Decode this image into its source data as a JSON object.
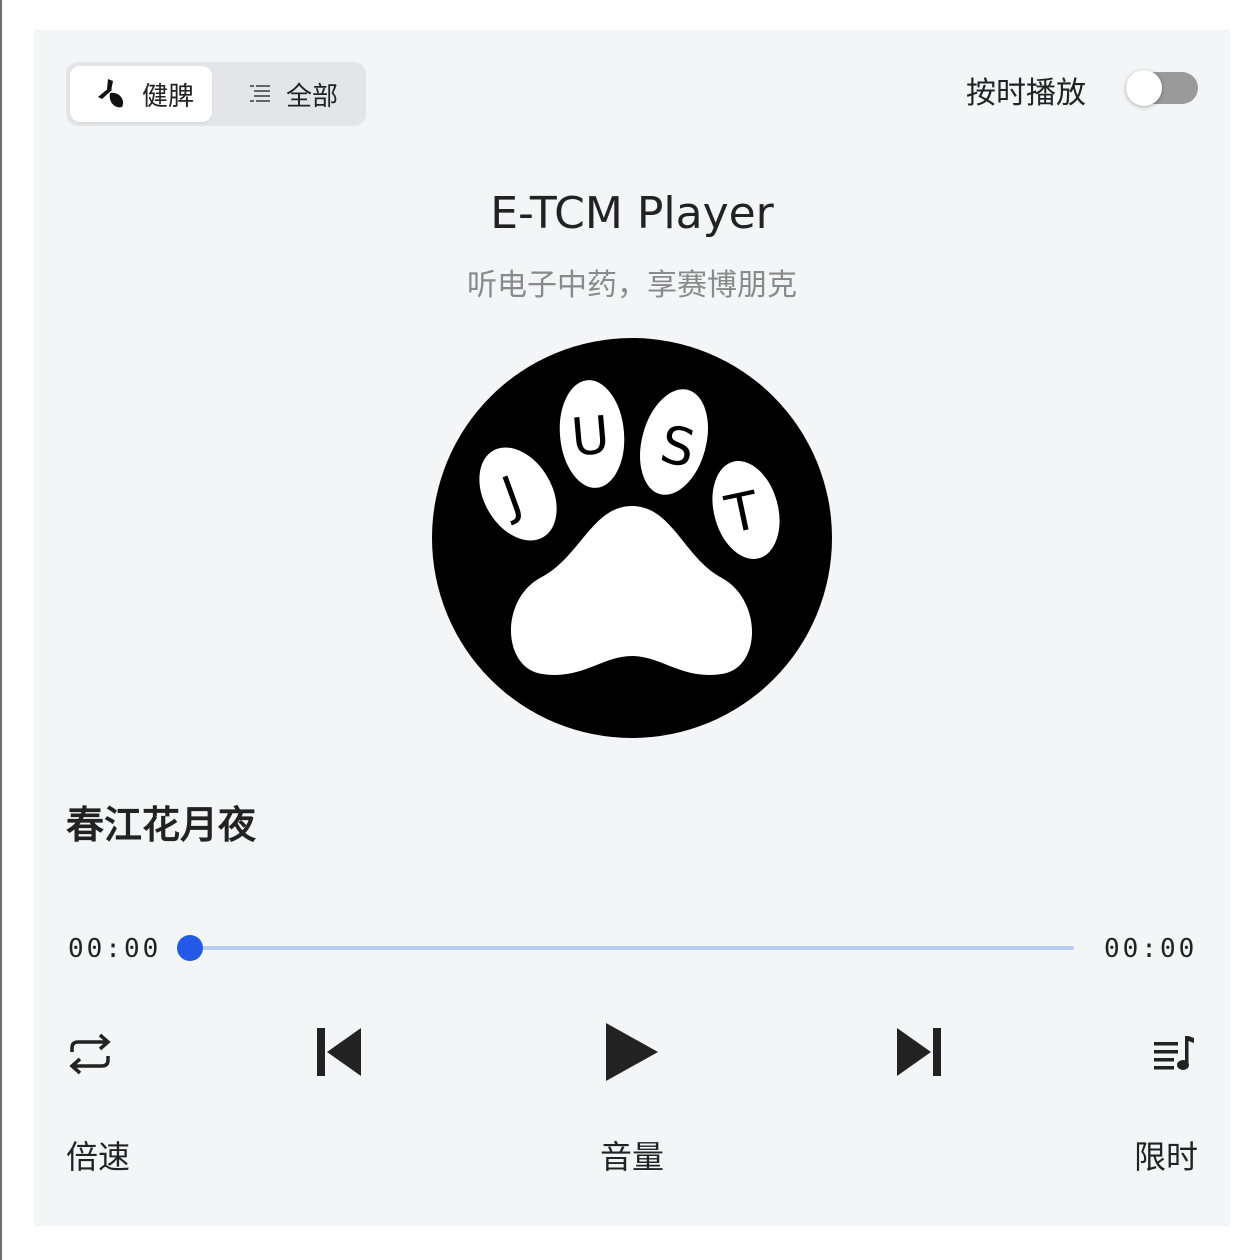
{
  "tabs": {
    "active_label": "健脾",
    "active_icon": "herb-icon",
    "all_label": "全部",
    "all_icon": "list-icon"
  },
  "timed_play": {
    "label": "按时播放",
    "enabled": false
  },
  "header": {
    "title": "E-TCM Player",
    "subtitle": "听电子中药，享赛博朋克"
  },
  "cover": {
    "letters": [
      "J",
      "U",
      "S",
      "T"
    ],
    "icon": "paw-logo"
  },
  "track": {
    "name": "春江花月夜",
    "current_time": "00:00",
    "duration": "00:00",
    "progress": 0
  },
  "controls": {
    "repeat_icon": "repeat-icon",
    "prev_icon": "skip-previous-icon",
    "play_icon": "play-icon",
    "next_icon": "skip-next-icon",
    "playlist_icon": "playlist-icon"
  },
  "options": {
    "speed_label": "倍速",
    "volume_label": "音量",
    "timer_label": "限时"
  },
  "colors": {
    "accent": "#2458e6",
    "track": "#b7cdf3",
    "toggle_off": "#9a9a9a",
    "background": "#f4f5f7"
  }
}
